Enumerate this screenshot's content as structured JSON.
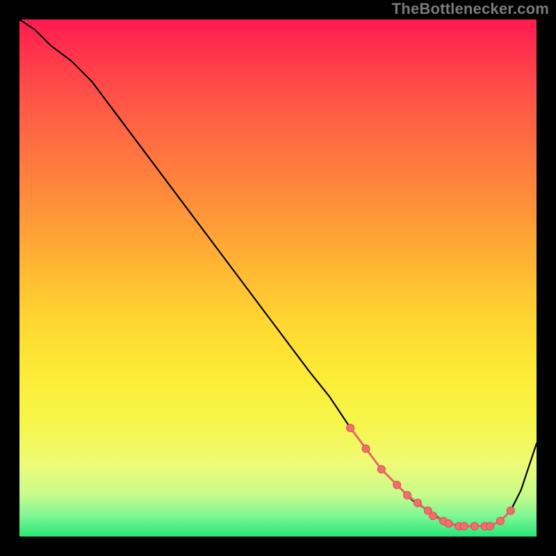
{
  "watermark": {
    "text": "TheBottlenecker.com"
  },
  "colors": {
    "curve": "#000000",
    "marker_fill": "#f46d6d",
    "marker_stroke": "#d84e4e",
    "marker_line": "#e86666",
    "background": "#000000"
  },
  "chart_data": {
    "type": "line",
    "title": "",
    "xlabel": "",
    "ylabel": "",
    "xlim": [
      0,
      100
    ],
    "ylim": [
      0,
      100
    ],
    "grid": false,
    "legend": false,
    "series": [
      {
        "name": "curve",
        "x": [
          0,
          3,
          6,
          10,
          14,
          20,
          26,
          32,
          38,
          44,
          50,
          56,
          60,
          64,
          67,
          70,
          73,
          76,
          79,
          82,
          85,
          88,
          91,
          93,
          95,
          97,
          100
        ],
        "y": [
          100,
          98,
          95,
          92,
          88,
          80,
          72,
          64,
          56,
          48,
          40,
          32,
          27,
          21,
          17,
          13,
          10,
          7,
          5,
          3,
          2,
          2,
          2,
          3,
          5,
          9,
          18
        ]
      }
    ],
    "markers": {
      "name": "highlight-points",
      "x": [
        64,
        67,
        70,
        73,
        75,
        77,
        79,
        80,
        82,
        83,
        85,
        86,
        88,
        90,
        91,
        93,
        95
      ],
      "y": [
        21,
        17,
        13,
        10,
        8,
        6.5,
        5,
        4,
        3,
        2.5,
        2,
        2,
        2,
        2,
        2,
        3,
        5
      ]
    }
  }
}
